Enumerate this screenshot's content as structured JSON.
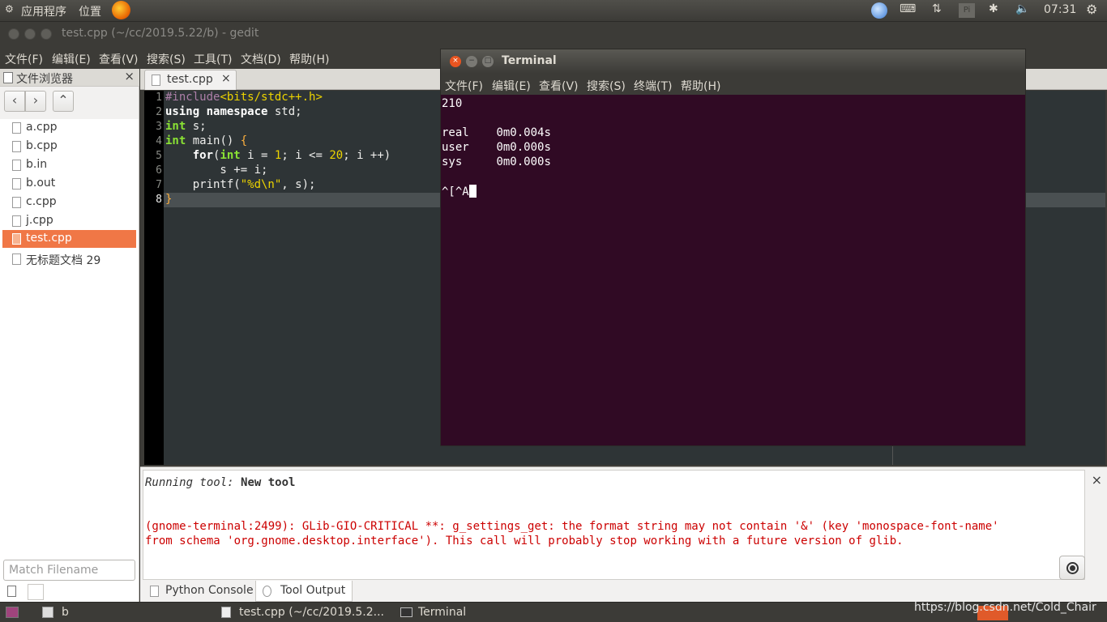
{
  "top_panel": {
    "apps_menu": "应用程序",
    "places_menu": "位置",
    "clock": "07:31"
  },
  "gedit": {
    "title": "test.cpp (~/cc/2019.5.22/b) - gedit",
    "menu": [
      "文件(F)",
      "编辑(E)",
      "查看(V)",
      "搜索(S)",
      "工具(T)",
      "文档(D)",
      "帮助(H)"
    ],
    "side_panel": {
      "title": "文件浏览器",
      "close": "×",
      "back": "‹",
      "forward": "›",
      "up": "⌃",
      "files": [
        "a.cpp",
        "b.cpp",
        "b.in",
        "b.out",
        "c.cpp",
        "j.cpp",
        "test.cpp",
        "无标题文档 29"
      ],
      "selected": "test.cpp",
      "match_placeholder": "Match Filename"
    },
    "tab": {
      "label": "test.cpp",
      "close": "×"
    },
    "editor": {
      "line_numbers": [
        "1",
        "2",
        "3",
        "4",
        "5",
        "6",
        "7",
        "8"
      ],
      "l1_pp": "#include",
      "l1_inc": "<bits/stdc++.h>",
      "l2_kw1": "using",
      "l2_kw2": "namespace",
      "l2_rest": " std;",
      "l3_ty": "int",
      "l3_rest": " s;",
      "l4_ty": "int",
      "l4_rest": " main() ",
      "l4_brace": "{",
      "l5_indent": "    ",
      "l5_for": "for",
      "l5_p1": "(",
      "l5_int": "int",
      "l5_p2": " i = ",
      "l5_n1": "1",
      "l5_p3": "; i <= ",
      "l5_n2": "20",
      "l5_p4": "; i ++)",
      "l6": "        s += i;",
      "l7_a": "    printf(",
      "l7_str": "\"%d\\n\"",
      "l7_b": ", s);",
      "l8_brace": "}"
    },
    "bottom_panel": {
      "running_label": "Running tool: ",
      "running_name": "New tool",
      "error_line1": "(gnome-terminal:2499): GLib-GIO-CRITICAL **: g_settings_get: the format string may not contain '&' (key 'monospace-font-name'",
      "error_line2": "from schema 'org.gnome.desktop.interface'). This call will probably stop working with a future version of glib.",
      "close": "×",
      "tabs": [
        "Python Console",
        "Tool Output"
      ]
    }
  },
  "terminal": {
    "title": "Terminal",
    "menu": [
      "文件(F)",
      "编辑(E)",
      "查看(V)",
      "搜索(S)",
      "终端(T)",
      "帮助(H)"
    ],
    "output": [
      "210",
      "",
      "real\t0m0.004s",
      "user\t0m0.000s",
      "sys\t0m0.000s",
      ""
    ],
    "prompt": "^[^A"
  },
  "taskbar": {
    "items": [
      "b",
      "test.cpp (~/cc/2019.5.2...",
      "Terminal"
    ],
    "watermark": "https://blog.csdn.net/Cold_Chair"
  },
  "colors": {
    "selection": "#f07746",
    "terminal_bg": "#300a24",
    "editor_bg": "#2e3436",
    "error_text": "#cc0000"
  }
}
